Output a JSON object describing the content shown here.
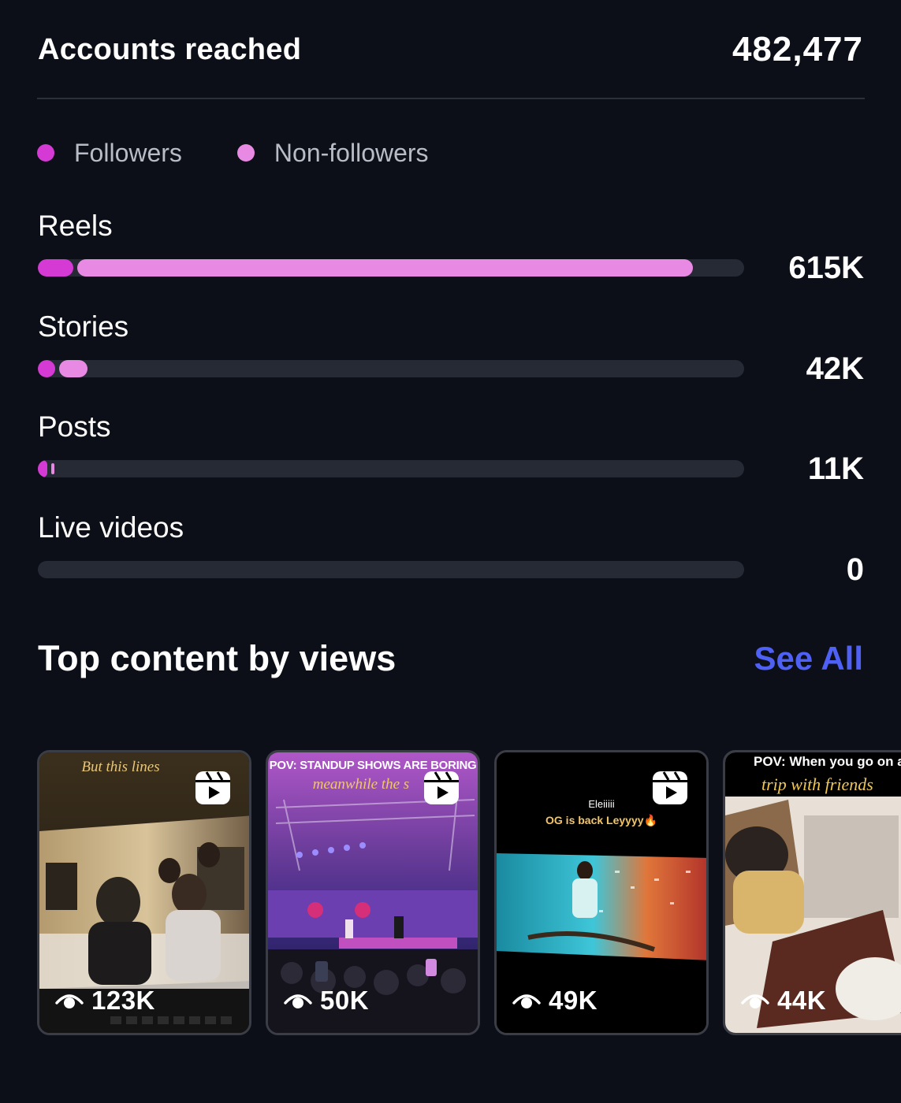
{
  "header": {
    "title": "Accounts reached",
    "total": "482,477"
  },
  "legend": [
    {
      "label": "Followers",
      "color": "#d63ad4"
    },
    {
      "label": "Non-followers",
      "color": "#e88ae3"
    }
  ],
  "colors": {
    "followers": "#d63ad4",
    "non_followers": "#e88ae3",
    "track": "#262a35",
    "accent_link": "#4f60f5",
    "background": "#0c0f17"
  },
  "metrics": [
    {
      "label": "Reels",
      "value": "615K",
      "followers_fraction": 0.05,
      "non_followers_fraction": 0.872
    },
    {
      "label": "Stories",
      "value": "42K",
      "followers_fraction": 0.025,
      "non_followers_fraction": 0.04
    },
    {
      "label": "Posts",
      "value": "11K",
      "followers_fraction": 0.013,
      "non_followers_fraction": 0.004
    },
    {
      "label": "Live videos",
      "value": "0",
      "followers_fraction": 0,
      "non_followers_fraction": 0
    }
  ],
  "top_content": {
    "title": "Top content by views",
    "see_all": "See All",
    "items": [
      {
        "caption": "But this lines",
        "caption2": "",
        "views": "123K",
        "icon": "reels-icon"
      },
      {
        "caption": "POV: STANDUP SHOWS ARE BORING",
        "caption2": "meanwhile the s",
        "views": "50K",
        "icon": "reels-icon"
      },
      {
        "caption": "Eleiiiii",
        "caption2": "OG is back Leyyyy🔥",
        "views": "49K",
        "icon": "reels-icon"
      },
      {
        "caption": "POV: When you go on a",
        "caption2": "trip with friends",
        "views": "44K",
        "icon": "reels-icon"
      }
    ]
  }
}
